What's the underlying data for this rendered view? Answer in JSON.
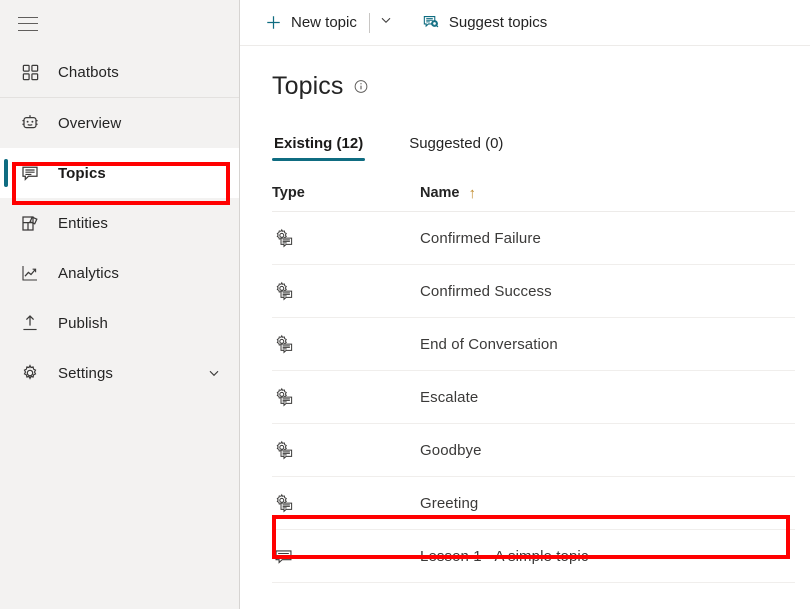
{
  "sidebar": {
    "menu_icon": "hamburger-icon",
    "items": [
      {
        "label": "Chatbots",
        "icon": "grid-apps-icon",
        "selected": false
      },
      {
        "label": "Overview",
        "icon": "bot-face-icon",
        "selected": false
      },
      {
        "label": "Topics",
        "icon": "speech-bubble-icon",
        "selected": true
      },
      {
        "label": "Entities",
        "icon": "entities-box-icon",
        "selected": false
      },
      {
        "label": "Analytics",
        "icon": "line-chart-icon",
        "selected": false
      },
      {
        "label": "Publish",
        "icon": "upload-icon",
        "selected": false
      },
      {
        "label": "Settings",
        "icon": "gear-icon",
        "selected": false,
        "expandable": true
      }
    ]
  },
  "command_bar": {
    "new_topic_label": "New topic",
    "new_topic_icon": "plus-icon",
    "new_topic_caret_icon": "chevron-down-icon",
    "suggest_topics_label": "Suggest topics",
    "suggest_topics_icon": "suggest-topics-icon"
  },
  "page": {
    "title": "Topics",
    "info_icon": "info-circle-icon"
  },
  "tabs": [
    {
      "label": "Existing (12)",
      "active": true
    },
    {
      "label": "Suggested (0)",
      "active": false
    }
  ],
  "table": {
    "columns": [
      {
        "label": "Type",
        "key": "type"
      },
      {
        "label": "Name",
        "key": "name",
        "sorted": true,
        "sort_icon": "sort-ascending-arrow",
        "sort_glyph": "↑"
      }
    ],
    "rows": [
      {
        "icon": "system-topic-icon",
        "name": "Confirmed Failure"
      },
      {
        "icon": "system-topic-icon",
        "name": "Confirmed Success"
      },
      {
        "icon": "system-topic-icon",
        "name": "End of Conversation"
      },
      {
        "icon": "system-topic-icon",
        "name": "Escalate"
      },
      {
        "icon": "system-topic-icon",
        "name": "Goodbye"
      },
      {
        "icon": "system-topic-icon",
        "name": "Greeting",
        "highlighted": true
      },
      {
        "icon": "user-topic-icon",
        "name": "Lesson 1 - A simple topic"
      }
    ]
  },
  "annotations": [
    {
      "name": "topics-nav-highlight",
      "color": "#ff0000",
      "target": "sidebar-item-topics"
    },
    {
      "name": "greeting-row-highlight",
      "color": "#ff0000",
      "target": "table-row-greeting"
    }
  ],
  "colors": {
    "accent": "#0f6c81",
    "annotation": "#ff0000",
    "sidebar_bg": "#f3f2f1",
    "sort_arrow": "#c08a2a"
  }
}
